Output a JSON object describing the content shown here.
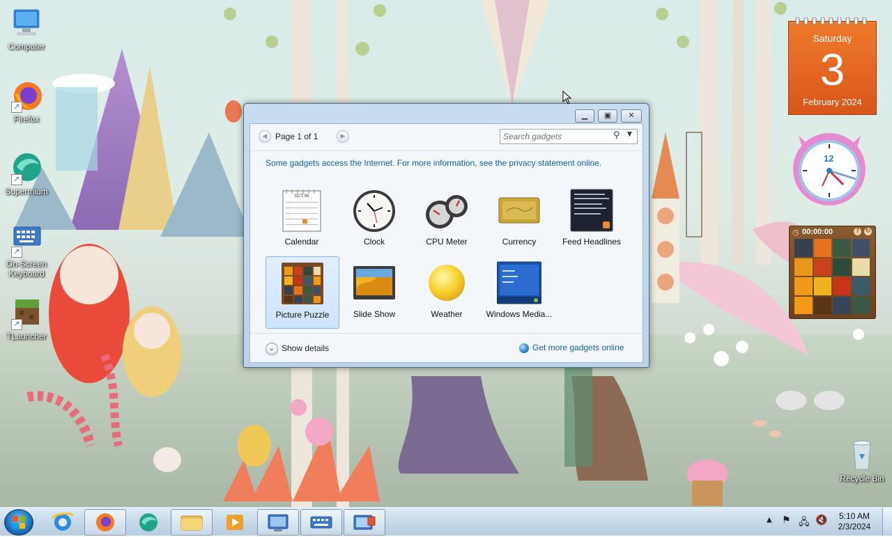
{
  "desktop_icons": [
    {
      "label": "Computer",
      "icon": "computer-icon"
    },
    {
      "label": "Firefox",
      "icon": "firefox-icon"
    },
    {
      "label": "Supermium",
      "icon": "supermium-icon"
    },
    {
      "label": "On-Screen Keyboard",
      "icon": "keyboard-icon"
    },
    {
      "label": "TLauncher",
      "icon": "tlauncher-icon"
    },
    {
      "label": "Recycle Bin",
      "icon": "recycle-bin-icon"
    }
  ],
  "gallery": {
    "page_label": "Page 1 of 1",
    "search_placeholder": "Search gadgets",
    "notice": "Some gadgets access the Internet.  For more information, see the privacy statement online.",
    "gadgets": [
      {
        "label": "Calendar",
        "icon": "calendar-gadget-icon"
      },
      {
        "label": "Clock",
        "icon": "clock-gadget-icon"
      },
      {
        "label": "CPU Meter",
        "icon": "cpu-meter-gadget-icon"
      },
      {
        "label": "Currency",
        "icon": "currency-gadget-icon"
      },
      {
        "label": "Feed Headlines",
        "icon": "feed-headlines-gadget-icon"
      },
      {
        "label": "Picture Puzzle",
        "icon": "picture-puzzle-gadget-icon",
        "selected": true
      },
      {
        "label": "Slide Show",
        "icon": "slide-show-gadget-icon"
      },
      {
        "label": "Weather",
        "icon": "weather-gadget-icon"
      },
      {
        "label": "Windows Media...",
        "icon": "windows-media-gadget-icon"
      }
    ],
    "show_details": "Show details",
    "get_more": "Get more gadgets online",
    "calendar_thumb_month": "OCT 06"
  },
  "calendar_gadget": {
    "day_name": "Saturday",
    "day_number": "3",
    "month_year": "February 2024"
  },
  "clock_gadget": {
    "number": "12"
  },
  "puzzle_gadget": {
    "timer": "00:00:00"
  },
  "taskbar": {
    "items": [
      "start-orb",
      "internet-explorer-icon",
      "firefox-icon",
      "supermium-icon",
      "explorer-folder-icon",
      "media-player-icon",
      "control-panel-icon",
      "keyboard-icon",
      "desktop-gadgets-icon"
    ],
    "time": "5:10 AM",
    "date": "2/3/2024"
  },
  "colors": {
    "accent": "#1060b8",
    "calendar_orange": "#e0621f",
    "taskbar": "#c3d7e8"
  }
}
